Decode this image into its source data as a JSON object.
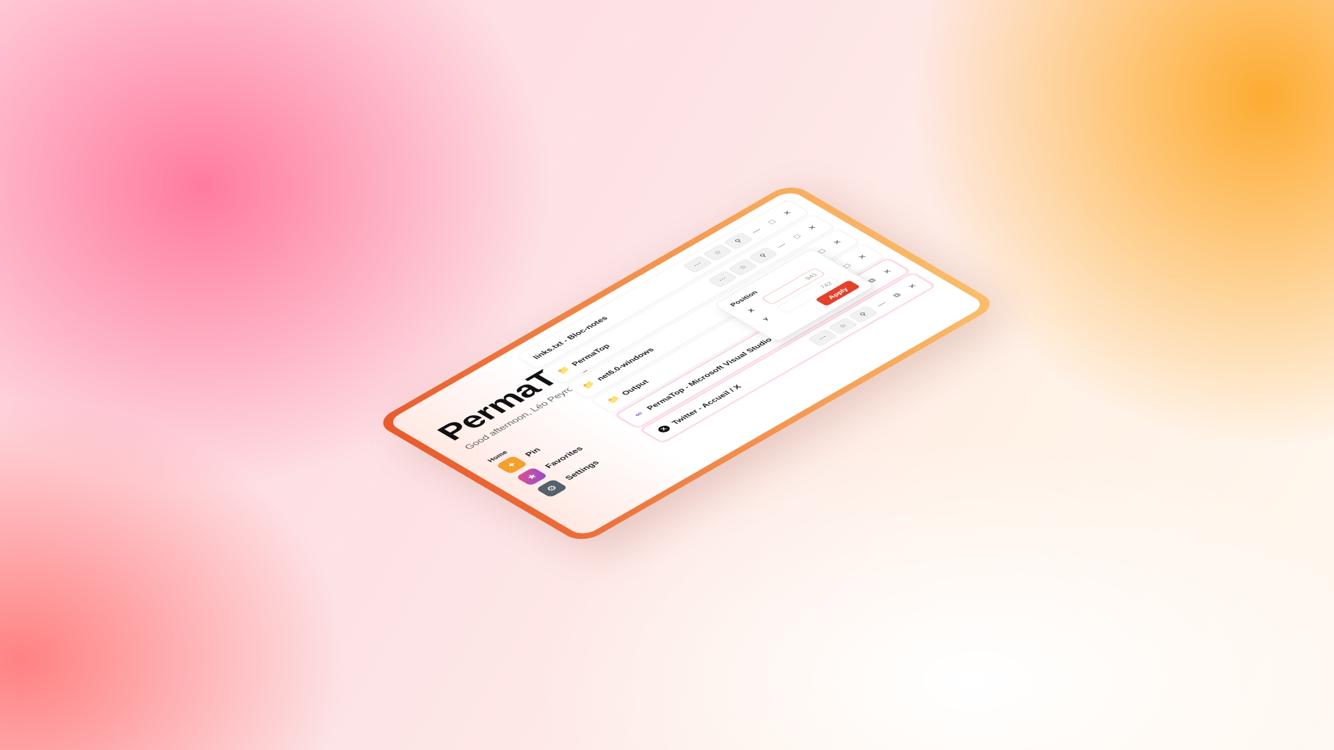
{
  "app": {
    "title": "PermaTop",
    "greeting": "Good afternoon, Léo Peyronnet."
  },
  "titlebar": {
    "minimize_glyph": "—",
    "close_glyph": "✕"
  },
  "sidebar": {
    "section_label": "Home",
    "items": [
      {
        "label": "Pin",
        "icon": "pin-icon",
        "color": "#f4a02a"
      },
      {
        "label": "Favorites",
        "icon": "star-icon",
        "color": "#c44bb0"
      },
      {
        "label": "Settings",
        "icon": "gear-icon",
        "color": "#55606b"
      }
    ]
  },
  "windows": [
    {
      "label": "links.txt - Bloc-notes",
      "icon": "none"
    },
    {
      "label": "PermaTop",
      "icon": "folder-icon"
    },
    {
      "label": "net6.0-windows",
      "icon": "folder-icon"
    },
    {
      "label": "Output",
      "icon": "folder-icon"
    },
    {
      "label": "PermaTop - Microsoft Visual Studio",
      "icon": "visual-studio-icon"
    },
    {
      "label": "Twitter - Accueil / X",
      "icon": "x-icon"
    }
  ],
  "row_buttons": {
    "more_glyph": "⋯",
    "favorite_glyph": "☆",
    "pin_glyph": "⚲",
    "minimize_glyph": "—",
    "maximize_glyph": "□",
    "restore_glyph": "⧉",
    "close_glyph": "✕"
  },
  "position_popup": {
    "title": "Position",
    "x_label": "X",
    "y_label": "Y",
    "x_value": "941",
    "y_value": "742",
    "apply_label": "Apply"
  },
  "colors": {
    "accent": "#e3412a",
    "frame_start": "#e85a2c",
    "frame_end": "#fbbf6a"
  }
}
